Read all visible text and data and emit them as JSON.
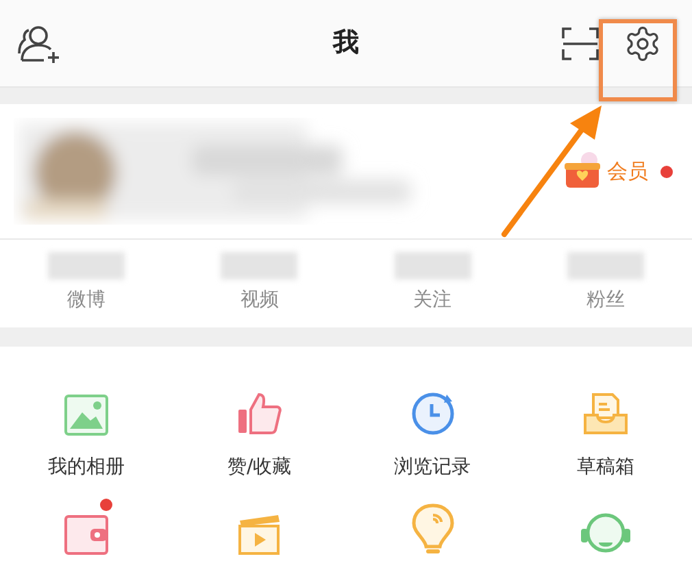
{
  "header": {
    "title": "我"
  },
  "profile": {
    "member_label": "会员",
    "member_unread": true
  },
  "stats": [
    {
      "label": "微博"
    },
    {
      "label": "视频"
    },
    {
      "label": "关注"
    },
    {
      "label": "粉丝"
    }
  ],
  "tools": [
    {
      "kind": "album",
      "label": "我的相册",
      "badge": false
    },
    {
      "kind": "like",
      "label": "赞/收藏",
      "badge": false
    },
    {
      "kind": "history",
      "label": "浏览记录",
      "badge": false
    },
    {
      "kind": "drafts",
      "label": "草稿箱",
      "badge": false
    },
    {
      "kind": "wallet",
      "badge": true
    },
    {
      "kind": "video",
      "badge": false
    },
    {
      "kind": "bulb",
      "badge": false
    },
    {
      "kind": "headset",
      "badge": false
    }
  ]
}
